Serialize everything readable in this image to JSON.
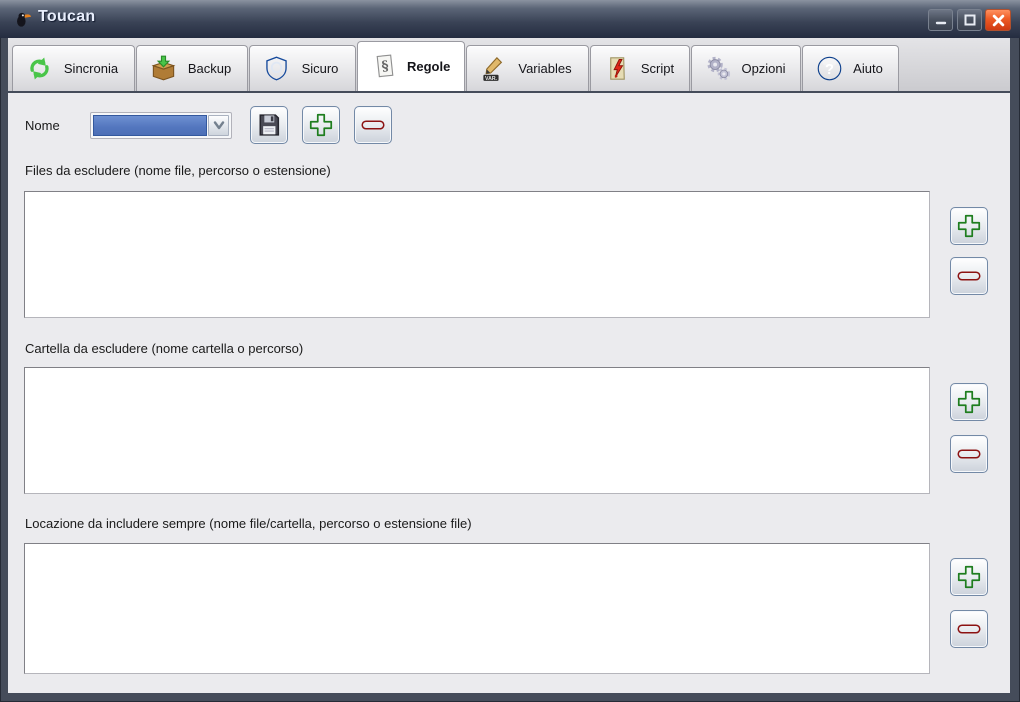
{
  "window": {
    "title": "Toucan",
    "controls": {
      "minimize": "minimize",
      "maximize": "maximize",
      "close": "close"
    }
  },
  "tabs": [
    {
      "label": "Sincronia",
      "icon": "sync-icon",
      "selected": false
    },
    {
      "label": "Backup",
      "icon": "backup-box-icon",
      "selected": false
    },
    {
      "label": "Sicuro",
      "icon": "shield-icon",
      "selected": false
    },
    {
      "label": "Regole",
      "icon": "rules-paper-icon",
      "selected": true
    },
    {
      "label": "Variables",
      "icon": "pencil-var-icon",
      "selected": false
    },
    {
      "label": "Script",
      "icon": "script-bolt-icon",
      "selected": false
    },
    {
      "label": "Opzioni",
      "icon": "gears-icon",
      "selected": false
    },
    {
      "label": "Aiuto",
      "icon": "help-icon",
      "selected": false
    }
  ],
  "toolbar": {
    "name_label": "Nome",
    "combo_value": "",
    "buttons": [
      {
        "name": "save-profile",
        "icon": "floppy-disk-icon"
      },
      {
        "name": "add-profile",
        "icon": "plus-icon"
      },
      {
        "name": "remove-profile",
        "icon": "minus-icon"
      }
    ]
  },
  "sections": [
    {
      "id": "exclude-files",
      "label": "Files da escludere (nome file, percorso o estensione)",
      "items": []
    },
    {
      "id": "exclude-folders",
      "label": "Cartella da escludere (nome cartella o percorso)",
      "items": []
    },
    {
      "id": "always-include",
      "label": "Locazione da includere sempre (nome file/cartella, percorso o estensione file)",
      "items": []
    }
  ],
  "colors": {
    "titlebar_dark": "#242c40",
    "close_button": "#ed5a24",
    "combo_selection_blue": "#5376be",
    "add_green": "#3db53d",
    "remove_red": "#c81c1c",
    "panel_bg": "#ebebee",
    "selected_tab_bg": "#ffffff"
  }
}
